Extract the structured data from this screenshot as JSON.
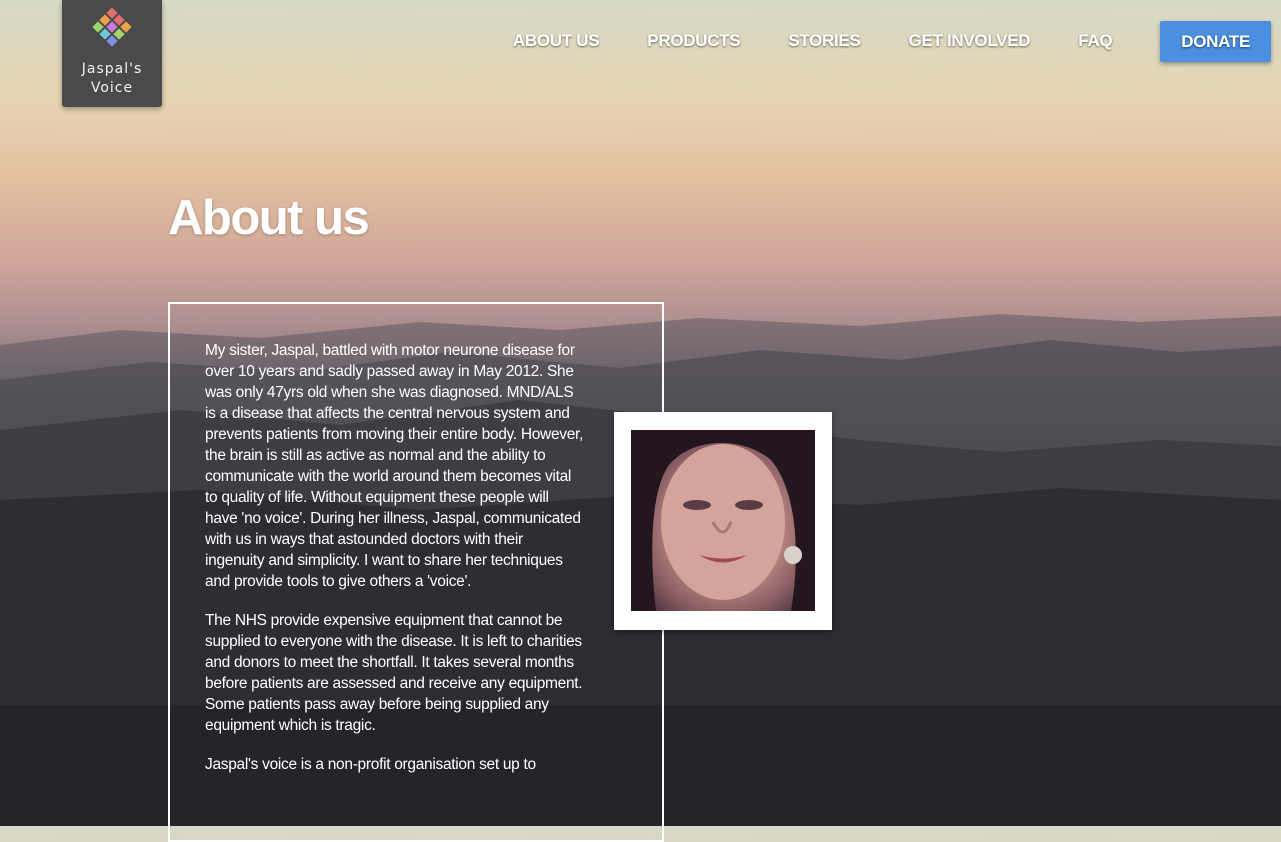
{
  "logo": {
    "line1": "Jaspal's",
    "line2": "Voice"
  },
  "nav": {
    "items": [
      "ABOUT US",
      "PRODUCTS",
      "STORIES",
      "GET INVOLVED",
      "FAQ"
    ],
    "donate": "DONATE"
  },
  "page_title": "About us",
  "about": {
    "paragraphs": [
      "My sister, Jaspal, battled with motor neurone disease for over 10 years and sadly passed away in May 2012. She was only 47yrs old when she was diagnosed. MND/ALS is a disease that affects the central nervous system and prevents patients from moving their entire body. However, the brain is still as active as normal and the ability to communicate with the world around them becomes vital to quality of life. Without equipment these people will have 'no voice'. During her illness, Jaspal, communicated with us in ways that astounded doctors with their ingenuity and simplicity. I want to share her techniques and provide tools to give others a 'voice'.",
      "The NHS provide expensive equipment that cannot be supplied to everyone with the disease. It is left to charities and donors to meet the shortfall. It takes several months before patients are assessed and receive any equipment. Some patients pass away before being supplied any equipment which is tragic.",
      "Jaspal's voice is a non-profit organisation set up to"
    ]
  },
  "colors": {
    "donate_button": "#4a8fe0",
    "logo_bg": "#4a4a4a"
  }
}
